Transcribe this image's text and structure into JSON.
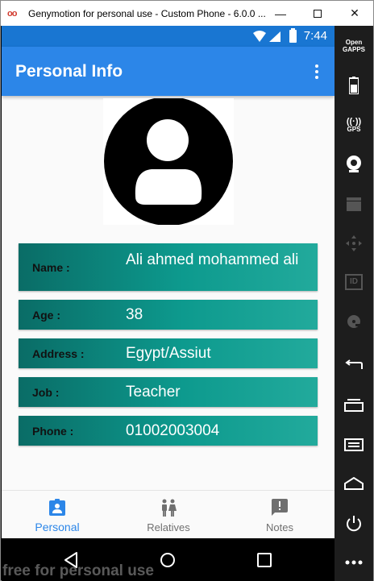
{
  "window": {
    "title": "Genymotion for personal use - Custom Phone - 6.0.0 ...",
    "logo_text": "oo",
    "minimize": "—",
    "close": "✕"
  },
  "status_bar": {
    "time": "7:44"
  },
  "app_bar": {
    "title": "Personal Info"
  },
  "person": {
    "fields": [
      {
        "label": "Name :",
        "value": "Ali ahmed mohammed ali"
      },
      {
        "label": "Age :",
        "value": "38"
      },
      {
        "label": "Address :",
        "value": "Egypt/Assiut"
      },
      {
        "label": "Job :",
        "value": "Teacher"
      },
      {
        "label": "Phone :",
        "value": "01002003004"
      }
    ]
  },
  "bottom_nav": {
    "items": [
      {
        "label": "Personal",
        "icon": "contact-card-icon",
        "active": true
      },
      {
        "label": "Relatives",
        "icon": "people-icon",
        "active": false
      },
      {
        "label": "Notes",
        "icon": "feedback-icon",
        "active": false
      }
    ]
  },
  "sidebar": {
    "gapps_line1": "Open",
    "gapps_line2": "GAPPS",
    "gps_label": "GPS",
    "id_label": "ID"
  },
  "colors": {
    "primary": "#2c86e8",
    "status_bar": "#1976d2",
    "row_gradient_start": "#0a6c66",
    "row_gradient_end": "#22aa9c"
  },
  "watermark": "free for personal use"
}
